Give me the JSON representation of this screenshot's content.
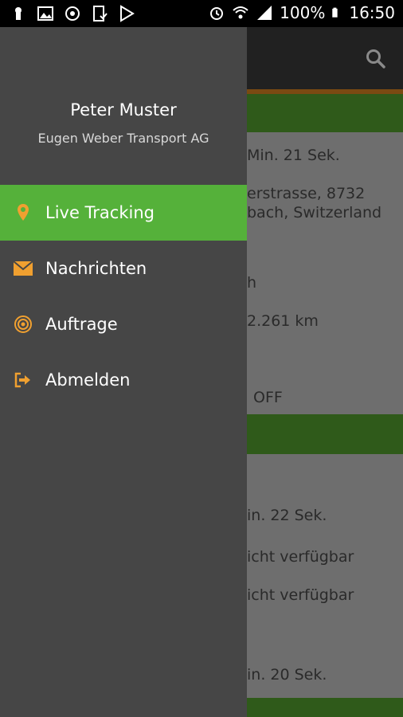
{
  "status_bar": {
    "battery": "100%",
    "time": "16:50"
  },
  "drawer": {
    "user_name": "Peter Muster",
    "company": "Eugen Weber Transport AG",
    "menu": [
      {
        "label": "Live Tracking",
        "icon": "location-pin-icon",
        "active": true
      },
      {
        "label": "Nachrichten",
        "icon": "envelope-icon",
        "active": false
      },
      {
        "label": "Auftrage",
        "icon": "target-icon",
        "active": false
      },
      {
        "label": "Abmelden",
        "icon": "logout-icon",
        "active": false
      }
    ]
  },
  "background": {
    "card1": {
      "duration": "Min. 21 Sek.",
      "address_line1": "erstrasse, 8732",
      "address_line2": "bach, Switzerland",
      "speed": "h",
      "distance": "2.261 km",
      "engine": "OFF"
    },
    "card2": {
      "duration": "in. 22 Sek.",
      "value1": "icht verfügbar",
      "value2": "icht verfügbar",
      "duration2": "in. 20 Sek."
    }
  },
  "colors": {
    "accent": "#55b13a",
    "drawer_bg": "#464646",
    "icon_orange": "#f0a030"
  }
}
